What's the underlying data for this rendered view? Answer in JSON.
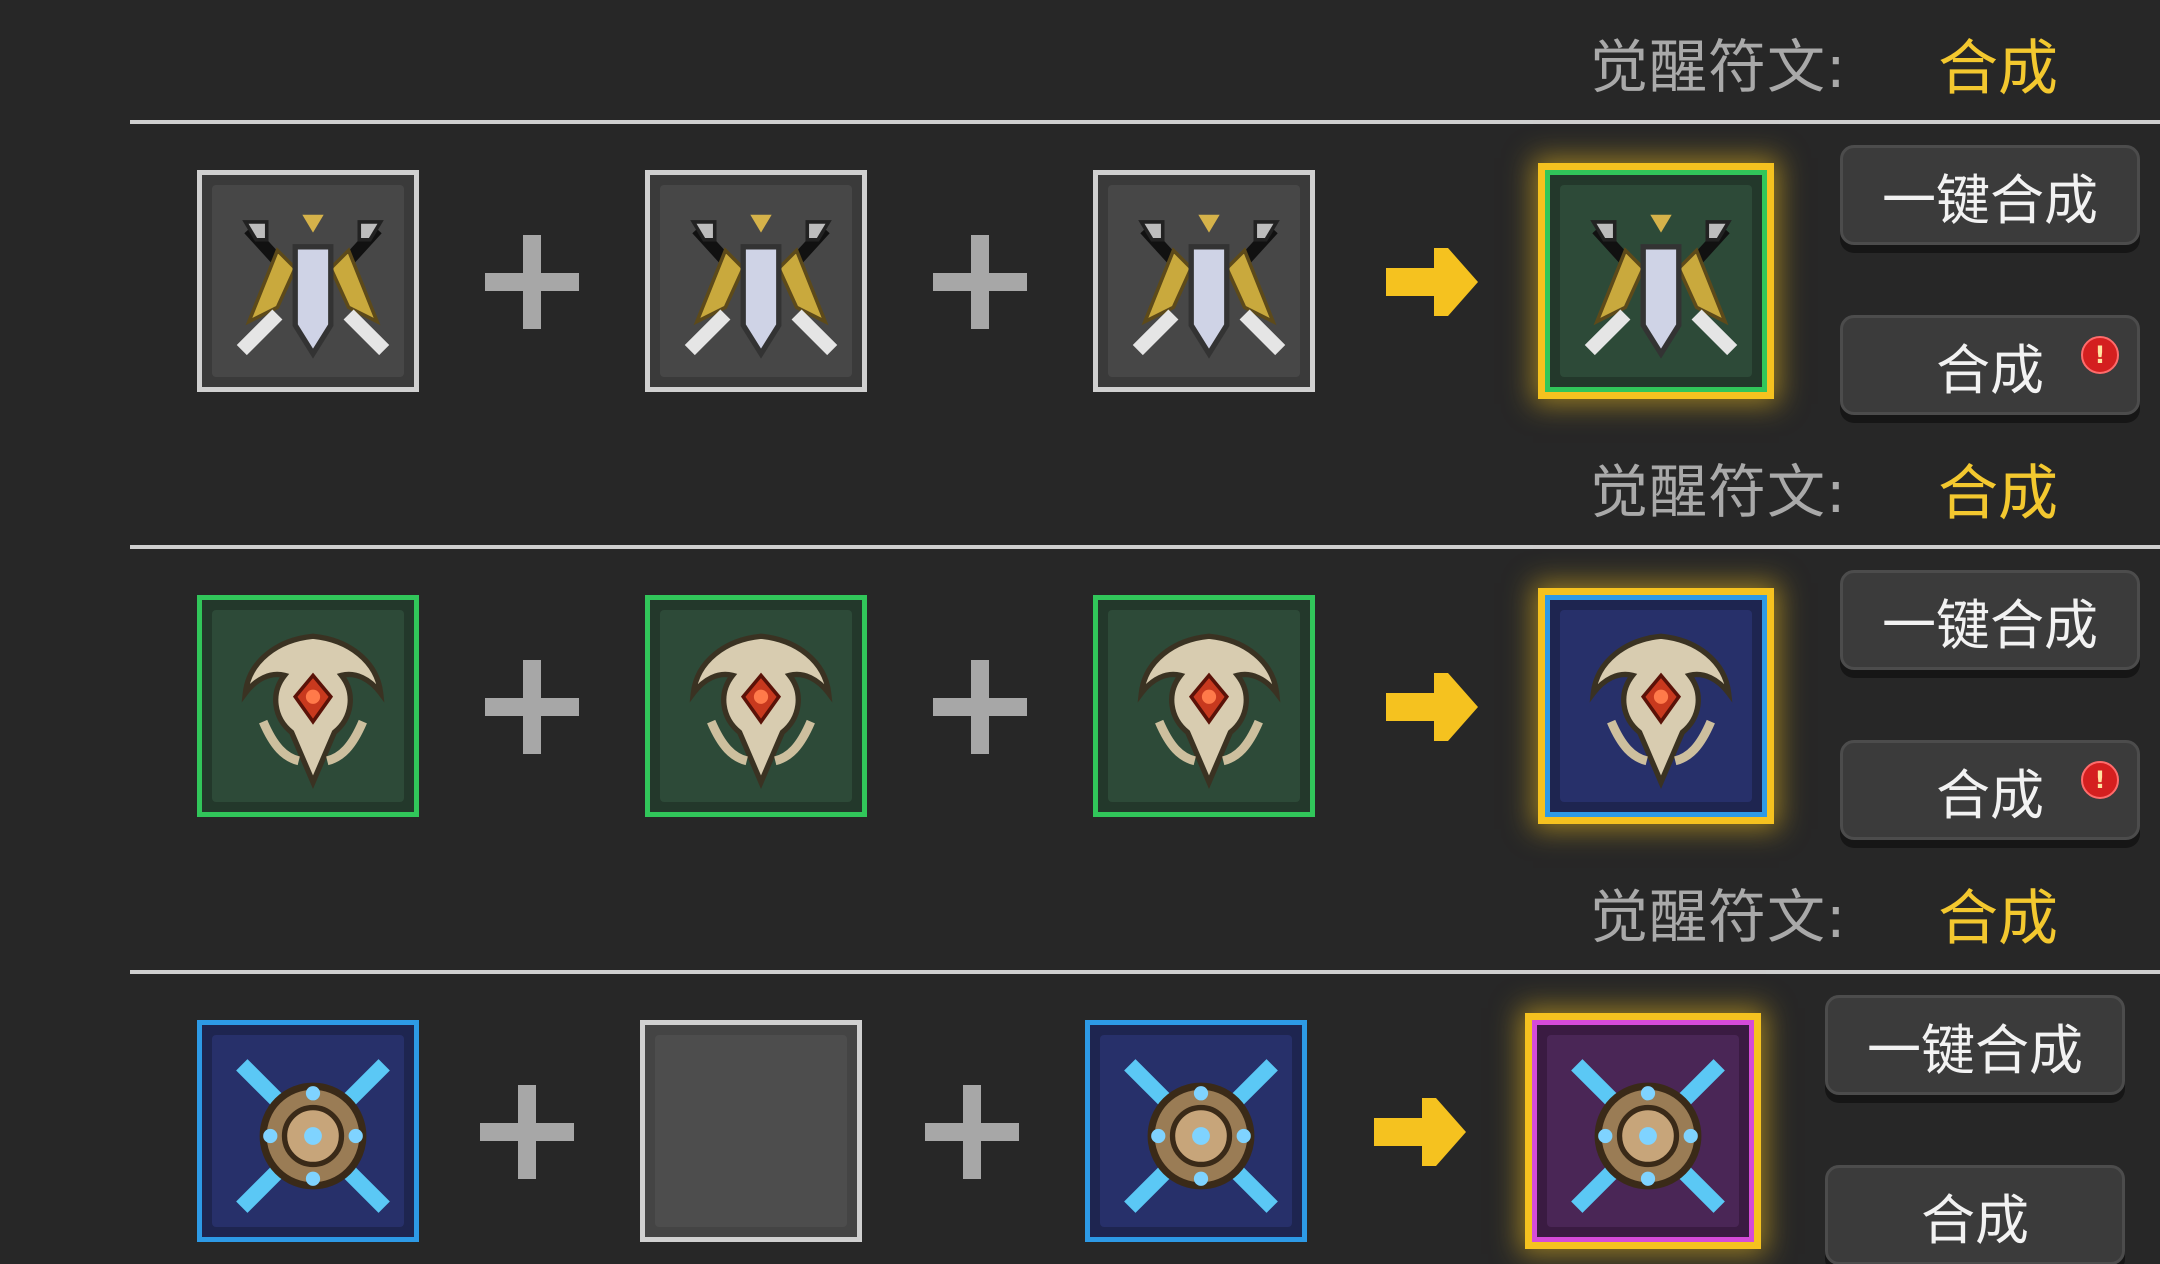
{
  "rows": [
    {
      "header_label": "觉醒符文:",
      "header_value": "合成",
      "inputs": [
        "shield-rune",
        "shield-rune",
        "shield-rune"
      ],
      "input_tier": "gray",
      "output": "shield-rune",
      "output_tier": "green",
      "btn_all": "一键合成",
      "btn_one": "合成",
      "has_alert": true
    },
    {
      "header_label": "觉醒符文:",
      "header_value": "合成",
      "inputs": [
        "crest-rune",
        "crest-rune",
        "crest-rune"
      ],
      "input_tier": "green",
      "output": "crest-rune",
      "output_tier": "blue",
      "btn_all": "一键合成",
      "btn_one": "合成",
      "has_alert": true
    },
    {
      "header_label": "觉醒符文:",
      "header_value": "合成",
      "inputs": [
        "orb-rune",
        "empty",
        "orb-rune"
      ],
      "input_tier": "blue",
      "output": "orb-rune",
      "output_tier": "purple",
      "btn_all": "一键合成",
      "btn_one": "合成",
      "has_alert": false
    }
  ],
  "alert_glyph": "!",
  "colors": {
    "background": "#272727",
    "accent_gold": "#f3c82f",
    "tier_gray": "#d0d0d0",
    "tier_green": "#31c65a",
    "tier_blue": "#2d9ae6",
    "tier_purple": "#d54bd9",
    "alert_red": "#d41f1f"
  },
  "icons": {
    "plus": "plus-icon",
    "arrow": "arrow-right-icon",
    "alert": "alert-badge-icon"
  }
}
